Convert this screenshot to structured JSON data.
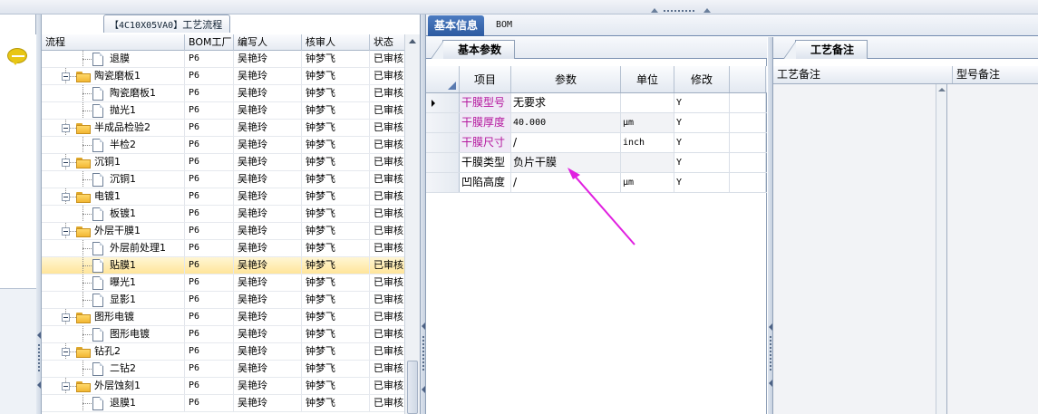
{
  "tree_panel": {
    "tab_code": "【4C10X05VA0】",
    "tab_title": "工艺流程",
    "columns": [
      "流程",
      "BOM工厂",
      "编写人",
      "核审人",
      "状态"
    ],
    "rows": [
      {
        "name": "退膜",
        "level": 2,
        "expand": false,
        "bom": "P6",
        "author": "吴艳玲",
        "reviewer": "钟梦飞",
        "status": "已审核",
        "selected": false
      },
      {
        "name": "陶瓷磨板1",
        "level": 1,
        "expand": true,
        "bom": "P6",
        "author": "吴艳玲",
        "reviewer": "钟梦飞",
        "status": "已审核",
        "selected": false
      },
      {
        "name": "陶瓷磨板1",
        "level": 2,
        "expand": false,
        "bom": "P6",
        "author": "吴艳玲",
        "reviewer": "钟梦飞",
        "status": "已审核",
        "selected": false
      },
      {
        "name": "抛光1",
        "level": 2,
        "expand": false,
        "bom": "P6",
        "author": "吴艳玲",
        "reviewer": "钟梦飞",
        "status": "已审核",
        "selected": false
      },
      {
        "name": "半成品检验2",
        "level": 1,
        "expand": true,
        "bom": "P6",
        "author": "吴艳玲",
        "reviewer": "钟梦飞",
        "status": "已审核",
        "selected": false
      },
      {
        "name": "半检2",
        "level": 2,
        "expand": false,
        "bom": "P6",
        "author": "吴艳玲",
        "reviewer": "钟梦飞",
        "status": "已审核",
        "selected": false
      },
      {
        "name": "沉铜1",
        "level": 1,
        "expand": true,
        "bom": "P6",
        "author": "吴艳玲",
        "reviewer": "钟梦飞",
        "status": "已审核",
        "selected": false
      },
      {
        "name": "沉铜1",
        "level": 2,
        "expand": false,
        "bom": "P6",
        "author": "吴艳玲",
        "reviewer": "钟梦飞",
        "status": "已审核",
        "selected": false
      },
      {
        "name": "电镀1",
        "level": 1,
        "expand": true,
        "bom": "P6",
        "author": "吴艳玲",
        "reviewer": "钟梦飞",
        "status": "已审核",
        "selected": false
      },
      {
        "name": "板镀1",
        "level": 2,
        "expand": false,
        "bom": "P6",
        "author": "吴艳玲",
        "reviewer": "钟梦飞",
        "status": "已审核",
        "selected": false
      },
      {
        "name": "外层干膜1",
        "level": 1,
        "expand": true,
        "bom": "P6",
        "author": "吴艳玲",
        "reviewer": "钟梦飞",
        "status": "已审核",
        "selected": false
      },
      {
        "name": "外层前处理1",
        "level": 2,
        "expand": false,
        "bom": "P6",
        "author": "吴艳玲",
        "reviewer": "钟梦飞",
        "status": "已审核",
        "selected": false
      },
      {
        "name": "贴膜1",
        "level": 2,
        "expand": false,
        "bom": "P6",
        "author": "吴艳玲",
        "reviewer": "钟梦飞",
        "status": "已审核",
        "selected": true
      },
      {
        "name": "曝光1",
        "level": 2,
        "expand": false,
        "bom": "P6",
        "author": "吴艳玲",
        "reviewer": "钟梦飞",
        "status": "已审核",
        "selected": false
      },
      {
        "name": "显影1",
        "level": 2,
        "expand": false,
        "bom": "P6",
        "author": "吴艳玲",
        "reviewer": "钟梦飞",
        "status": "已审核",
        "selected": false
      },
      {
        "name": "图形电镀",
        "level": 1,
        "expand": true,
        "bom": "P6",
        "author": "吴艳玲",
        "reviewer": "钟梦飞",
        "status": "已审核",
        "selected": false
      },
      {
        "name": "图形电镀",
        "level": 2,
        "expand": false,
        "bom": "P6",
        "author": "吴艳玲",
        "reviewer": "钟梦飞",
        "status": "已审核",
        "selected": false
      },
      {
        "name": "钻孔2",
        "level": 1,
        "expand": true,
        "bom": "P6",
        "author": "吴艳玲",
        "reviewer": "钟梦飞",
        "status": "已审核",
        "selected": false
      },
      {
        "name": "二钻2",
        "level": 2,
        "expand": false,
        "bom": "P6",
        "author": "吴艳玲",
        "reviewer": "钟梦飞",
        "status": "已审核",
        "selected": false
      },
      {
        "name": "外层蚀刻1",
        "level": 1,
        "expand": true,
        "bom": "P6",
        "author": "吴艳玲",
        "reviewer": "钟梦飞",
        "status": "已审核",
        "selected": false
      },
      {
        "name": "退膜1",
        "level": 2,
        "expand": false,
        "bom": "P6",
        "author": "吴艳玲",
        "reviewer": "钟梦飞",
        "status": "已审核",
        "selected": false
      }
    ]
  },
  "main_tabs": {
    "basic_info": "基本信息",
    "bom": "BOM"
  },
  "basic_params": {
    "tab_label": "基本参数",
    "columns": [
      "项目",
      "参数",
      "单位",
      "修改"
    ],
    "rows": [
      {
        "item": "干膜型号",
        "param": "无要求",
        "unit": "",
        "modify": "Y",
        "current": true,
        "highlight": true
      },
      {
        "item": "干膜厚度",
        "param": "40.000",
        "unit": "μm",
        "modify": "Y",
        "current": false,
        "highlight": true
      },
      {
        "item": "干膜尺寸",
        "param": "/",
        "unit": "inch",
        "modify": "Y",
        "current": false,
        "highlight": true
      },
      {
        "item": "干膜类型",
        "param": "负片干膜",
        "unit": "",
        "modify": "Y",
        "current": false,
        "highlight": false
      },
      {
        "item": "凹陷高度",
        "param": "/",
        "unit": "μm",
        "modify": "Y",
        "current": false,
        "highlight": false
      }
    ]
  },
  "notes": {
    "tab_label": "工艺备注",
    "col1": "工艺备注",
    "col2": "型号备注"
  },
  "colors": {
    "accent_tab": "#2c5aa0",
    "item_highlight": "#b5179e",
    "selected_row": "#ffe59a",
    "annotation_arrow": "#e020e0"
  }
}
